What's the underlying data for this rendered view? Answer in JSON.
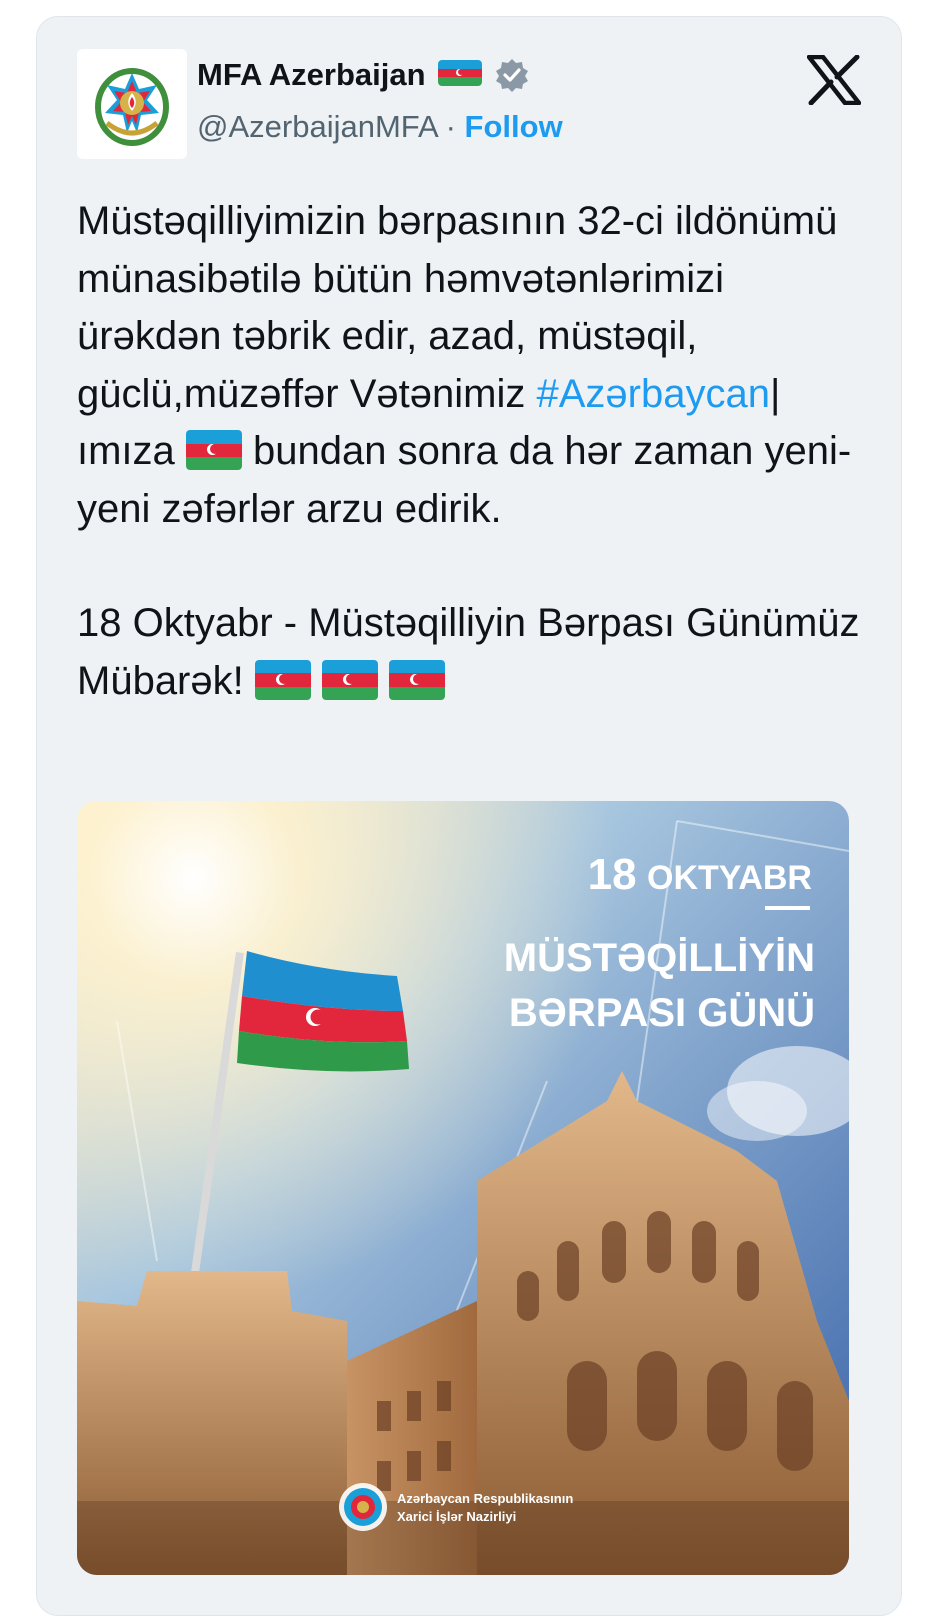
{
  "tweet": {
    "author_name": "MFA Azerbaijan",
    "handle": "@AzerbaijanMFA",
    "separator": "·",
    "follow_label": "Follow",
    "paragraph1_part1": "Müstəqilliyimizin bərpasının 32-ci ildönümü münasibətilə bütün həmvətənlərimizi ürəkdən təbrik edir, azad, müstəqil, güclü,müzəffər Vətənimiz ",
    "hashtag": "#Azərbaycan",
    "paragraph1_part2": "|ımıza",
    "paragraph1_part3": " bundan sonra da hər zaman yeni-yeni zəfərlər arzu edirik.",
    "paragraph2": "18 Oktyabr - Müstəqilliyin Bərpası Günümüz Mübarək!"
  },
  "media": {
    "date_number": "18",
    "date_month": "OKTYABR",
    "title_line1": "MÜSTƏQİLLİYİN",
    "title_line2": "BƏRPASI GÜNÜ",
    "ministry_line1": "Azərbaycan Respublikasının",
    "ministry_line2": "Xarici İşlər Nazirliyi"
  },
  "colors": {
    "link": "#1d9bf0",
    "text": "#0f1419",
    "secondary": "#536471",
    "card_bg": "#eef2f5",
    "flag_blue": "#1a9fd8",
    "flag_red": "#e2263b",
    "flag_green": "#35a354"
  },
  "icons": [
    "azerbaijan-emblem-icon",
    "azerbaijan-flag-icon",
    "verified-badge-icon",
    "x-logo-icon"
  ]
}
